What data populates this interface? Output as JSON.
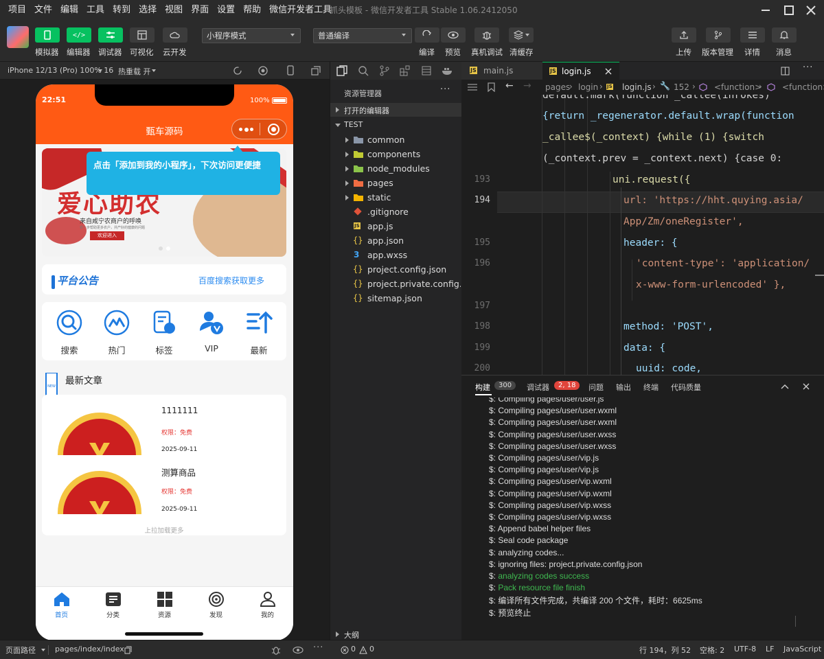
{
  "menu": [
    "项目",
    "文件",
    "编辑",
    "工具",
    "转到",
    "选择",
    "视图",
    "界面",
    "设置",
    "帮助",
    "微信开发者工具"
  ],
  "window_title": "抓头模板 - 微信开发者工具 Stable 1.06.2412050",
  "toolbar": {
    "simulator": "模拟器",
    "editor": "编辑器",
    "debugger": "调试器",
    "visual": "可视化",
    "cloud": "云开发",
    "mode_select": "小程序模式",
    "compile_select": "普通编译",
    "compile": "编译",
    "preview": "预览",
    "real_debug": "真机调试",
    "clear_cache": "清缓存",
    "upload": "上传",
    "version": "版本管理",
    "details": "详情",
    "messages": "消息"
  },
  "simbar": {
    "device": "iPhone 12/13 (Pro) 100% 16",
    "hot_reload": "热重载 开"
  },
  "phone": {
    "time": "22:51",
    "battery": "100%",
    "nav_title": "甄车源码",
    "tip": "点击「添加到我的小程序」，下次访问更便捷",
    "banner": {
      "headline": "爱心助农",
      "sub": "来自咸宁农商户的呼唤",
      "small": "农一步帮助更多农户，共产好的健康的问题",
      "btn": "欢迎进入"
    },
    "notice": {
      "logo": "平台公告",
      "link": "百度搜索获取更多"
    },
    "grid": [
      {
        "label": "搜索",
        "icon": "search-icon"
      },
      {
        "label": "热门",
        "icon": "hot-icon"
      },
      {
        "label": "标签",
        "icon": "tag-icon"
      },
      {
        "label": "VIP",
        "icon": "vip-icon"
      },
      {
        "label": "最新",
        "icon": "latest-icon"
      }
    ],
    "section_title": "最新文章",
    "section_badge": "NEW",
    "articles": [
      {
        "title": "1111111",
        "perm": "权限：免费",
        "date": "2025-09-11"
      },
      {
        "title": "测算商品",
        "perm": "权限：免费",
        "date": "2025-09-11"
      }
    ],
    "load_more": "上拉加载更多",
    "tabs": [
      {
        "label": "首页",
        "icon": "home-icon",
        "active": true
      },
      {
        "label": "分类",
        "icon": "category-icon"
      },
      {
        "label": "资源",
        "icon": "resource-icon"
      },
      {
        "label": "发现",
        "icon": "discover-icon"
      },
      {
        "label": "我的",
        "icon": "user-icon"
      }
    ]
  },
  "explorer": {
    "title": "资源管理器",
    "open_editors": "打开的编辑器",
    "root": "TEST",
    "items": [
      {
        "name": "common",
        "type": "folder",
        "color": "#8a96a8"
      },
      {
        "name": "components",
        "type": "folder",
        "color": "#c0ca33"
      },
      {
        "name": "node_modules",
        "type": "folder",
        "color": "#8bc34a"
      },
      {
        "name": "pages",
        "type": "folder",
        "color": "#ef6c43"
      },
      {
        "name": "static",
        "type": "folder",
        "color": "#f4b400"
      },
      {
        "name": ".gitignore",
        "type": "git"
      },
      {
        "name": "app.js",
        "type": "js"
      },
      {
        "name": "app.json",
        "type": "json"
      },
      {
        "name": "app.wxss",
        "type": "css"
      },
      {
        "name": "project.config.json",
        "type": "json"
      },
      {
        "name": "project.private.config.js...",
        "type": "json"
      },
      {
        "name": "sitemap.json",
        "type": "json"
      }
    ],
    "outline": "大纲"
  },
  "editor": {
    "tabs": [
      {
        "name": "main.js",
        "active": false
      },
      {
        "name": "login.js",
        "active": true
      }
    ],
    "breadcrumb": [
      "pages",
      "login",
      "login.js",
      "152",
      "<function>",
      "<function>"
    ],
    "line_numbers": [
      "193",
      "194",
      "195",
      "196",
      "197",
      "198",
      "199",
      "200"
    ],
    "code": [
      "default.mark(function _callee(inrokes)",
      "{return _regenerator.default.wrap(function",
      "_callee$(_context) {while (1) {switch",
      "(_context.prev = _context.next) {case 0:",
      "uni.request({",
      "url: 'https://hht.quying.asia/",
      "App/Zm/oneRegister',",
      "header: {",
      "'content-type': 'application/",
      "x-www-form-urlencoded' },",
      "method: 'POST',",
      "data: {",
      "uuid: code,"
    ]
  },
  "console": {
    "tabs": [
      {
        "name": "构建",
        "badge": "300"
      },
      {
        "name": "调试器",
        "badge": "2, 18"
      },
      {
        "name": "问题"
      },
      {
        "name": "输出"
      },
      {
        "name": "终端"
      },
      {
        "name": "代码质量"
      }
    ],
    "lines": [
      {
        "text": "$: Compiling pages/user/user.js",
        "color": "#dddddd"
      },
      {
        "text": "$: Compiling pages/user/user.wxml",
        "color": "#dddddd"
      },
      {
        "text": "$: Compiling pages/user/user.wxml",
        "color": "#dddddd"
      },
      {
        "text": "$: Compiling pages/user/user.wxss",
        "color": "#dddddd"
      },
      {
        "text": "$: Compiling pages/user/user.wxss",
        "color": "#dddddd"
      },
      {
        "text": "$: Compiling pages/user/vip.js",
        "color": "#dddddd"
      },
      {
        "text": "$: Compiling pages/user/vip.js",
        "color": "#dddddd"
      },
      {
        "text": "$: Compiling pages/user/vip.wxml",
        "color": "#dddddd"
      },
      {
        "text": "$: Compiling pages/user/vip.wxml",
        "color": "#dddddd"
      },
      {
        "text": "$: Compiling pages/user/vip.wxss",
        "color": "#dddddd"
      },
      {
        "text": "$: Compiling pages/user/vip.wxss",
        "color": "#dddddd"
      },
      {
        "text": "$: Append babel helper files",
        "color": "#dddddd"
      },
      {
        "text": "$: Seal code package",
        "color": "#dddddd"
      },
      {
        "text": "$: analyzing codes...",
        "color": "#dddddd"
      },
      {
        "text": "$: ignoring files: project.private.config.json",
        "color": "#dddddd"
      },
      {
        "prefix": "$: ",
        "text": "analyzing codes success",
        "color": "#3fb950"
      },
      {
        "prefix": "$: ",
        "text": "Pack resource file finish",
        "color": "#3fb950"
      },
      {
        "text": "$: 编译所有文件完成，共编译 200 个文件，耗时：6625ms",
        "color": "#dddddd"
      },
      {
        "text": "$: 预览终止",
        "color": "#dddddd"
      }
    ]
  },
  "status": {
    "page_path_label": "页面路径",
    "page_path": "pages/index/index",
    "errors": "0",
    "warnings": "0",
    "cursor": "行 194，列 52",
    "spaces": "空格: 2",
    "encoding": "UTF-8",
    "eol": "LF",
    "lang": "JavaScript"
  },
  "colors": {
    "brand_orange": "#ff5a14",
    "wechat_green": "#1aad19",
    "tip_blue": "#1fb2e4",
    "link_blue": "#2d8cf0",
    "accent_red": "#e53935"
  }
}
